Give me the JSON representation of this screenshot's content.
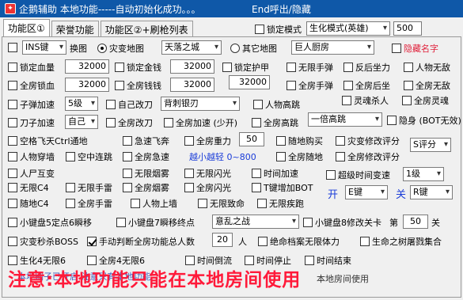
{
  "window": {
    "title": "企鹅辅助 本地功能-----自动初始化成功。。。",
    "title_hint": "End呼出/隐藏"
  },
  "tabs": [
    "功能区①",
    "荣誉功能",
    "功能区②+刷枪列表"
  ],
  "row1": {
    "lock_mode": "锁定模式",
    "mode_value": "生化模式(英雄)",
    "mode_number": "500"
  },
  "row2": {
    "ins_key": "INS键",
    "swap_map": "换图",
    "disaster_map": "灾变地图",
    "disaster_value": "天落之城",
    "other_map": "其它地图",
    "other_value": "巨人厨房",
    "hide_name": "隐藏名字"
  },
  "row3": {
    "lock_hp": "锁定血量",
    "hp_value": "32000",
    "lock_gold": "锁定金钱",
    "gold_value": "32000",
    "lock_armor": "锁定护甲",
    "unlimited_grenade": "无限手弹",
    "no_recoil": "反后坐力",
    "char_invincible": "人物无敌"
  },
  "row4": {
    "full_room_lock": "全房锁血",
    "lock_value": "32000",
    "full_room_gold": "全房钱钱",
    "gold_value": "32000",
    "extra_value": "32000",
    "full_room_grenade": "全房手弹",
    "full_room_recoil": "全房后坐",
    "full_room_invincible": "全房无敌"
  },
  "row5": {
    "bullet_speed": "子弹加速",
    "bullet_level": "5级",
    "self_knife": "自己改刀",
    "knife_value": "背刺银刃",
    "char_jump": "人物高跳",
    "ghost_kill": "灵魂杀人",
    "full_room_ghost": "全房灵魂"
  },
  "row6": {
    "knife_speed": "刀子加速",
    "knife_speed_value": "自己",
    "full_room_knife": "全房改刀",
    "full_room_speed": "全房加速 (少开)",
    "full_room_jump": "全房高跳",
    "jump_value": "一倍高跳",
    "invisible": "隐身 (BOT无效)"
  },
  "row7": {
    "ctrl_fly": "空格飞天Ctrl通地",
    "sprint_fly": "急速飞奔",
    "full_room_gravity": "全房重力",
    "gravity_value": "50",
    "buy_anywhere": "随地购买",
    "disaster_score": "灾变修改评分",
    "score_value": "S评分"
  },
  "row8": {
    "wall_hack": "人物穿墙",
    "air_combo": "空中连跳",
    "full_room_sprint": "全房急速",
    "jump_hint": "越小越轻 0~800",
    "full_room_anywhere": "全房随地",
    "full_room_score": "全房修改评分"
  },
  "row9": {
    "pvp": "人尸互变",
    "no_smoke": "无限烟雾",
    "no_flash": "无限闪光",
    "time_speed": "时间加速",
    "super_time": "超级时间变速",
    "super_value": "1级"
  },
  "row10": {
    "no_c4": "无限C4",
    "no_grenade": "无限手雷",
    "full_smoke": "全房烟雾",
    "full_flash": "全房闪光",
    "t_bot": "T键增加BOT"
  },
  "row11": {
    "c4_anywhere": "随地C4",
    "full_grenade": "全房手雷",
    "char_climb": "人物上墙",
    "no_fatal": "无限致命",
    "no_disease": "无限疾跑",
    "open_label": "开",
    "open_key": "E键",
    "close_label": "关",
    "close_key": "R键"
  },
  "row12": {
    "mini5": "小键盘5定点6瞬移",
    "mini7": "小键盘7瞬移终点",
    "mini7_value": "意乱之战",
    "mini8": "小键盘8修改关卡",
    "level_prefix": "第",
    "level_value": "50",
    "level_suffix": "关"
  },
  "row13": {
    "disaster_boss": "灾变秒杀BOSS",
    "manual_total": "手动判断全房功能总人数",
    "total_value": "20",
    "total_suffix": "人",
    "archive_hp": "绝命档案无限体力",
    "tree_combo": "生命之树屠戮集合"
  },
  "row14": {
    "bio4": "生化4无限6",
    "full_bio4": "全房4无限6",
    "time_reverse": "时间倒流",
    "time_stop": "时间停止",
    "time_end": "时间结束"
  },
  "notice": "注意:本地功能只能在本地房间使用",
  "footer": {
    "ghost_text": "本地刷子已开启 注意只有本地功能",
    "ghost_text2": "本地房间使用"
  }
}
